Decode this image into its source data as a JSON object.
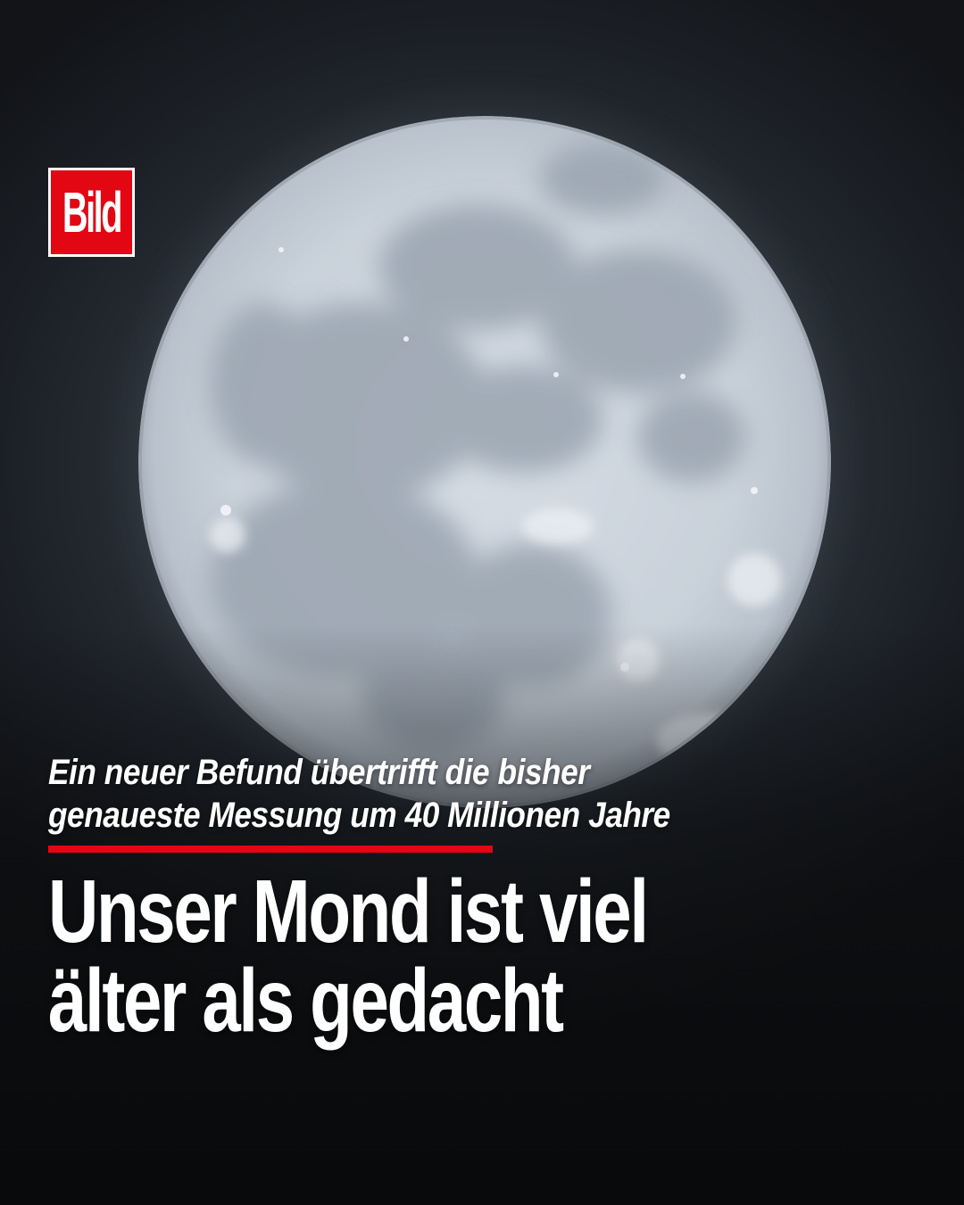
{
  "brand": {
    "logo_text": "Bild",
    "logo_color": "#e30613"
  },
  "article": {
    "kicker_line1": "Ein neuer Befund übertrifft die bisher",
    "kicker_line2": "genaueste Messung um 40 Millionen Jahre",
    "headline_line1": "Unser Mond ist viel",
    "headline_line2": "älter als gedacht"
  },
  "image": {
    "subject": "moon-photo"
  }
}
